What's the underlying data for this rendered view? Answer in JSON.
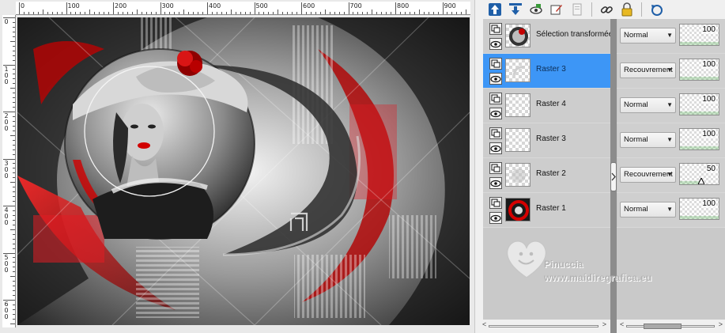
{
  "rulers": {
    "top_labels": [
      "0",
      "100",
      "200",
      "300",
      "400",
      "500",
      "600",
      "700",
      "800",
      "900"
    ],
    "left_labels": [
      "0",
      "100",
      "200",
      "300",
      "400",
      "500",
      "600"
    ]
  },
  "toolbar": {
    "icons": [
      "promote-layer-icon",
      "demote-layer-icon",
      "visibility-toggle-icon",
      "edit-layer-icon",
      "layer-properties-icon",
      "link-icon",
      "lock-icon",
      "refresh-icon"
    ]
  },
  "layers": [
    {
      "name": "Sélection transformée",
      "blend_mode": "Normal",
      "opacity": "100",
      "opacity_value": 100,
      "selected": false,
      "thumb": "portrait"
    },
    {
      "name": "Raster 3",
      "blend_mode": "Recouvrement",
      "opacity": "100",
      "opacity_value": 100,
      "selected": true,
      "thumb": "circle"
    },
    {
      "name": "Raster 4",
      "blend_mode": "Normal",
      "opacity": "100",
      "opacity_value": 100,
      "selected": false,
      "thumb": "empty"
    },
    {
      "name": "Raster 3",
      "blend_mode": "Normal",
      "opacity": "100",
      "opacity_value": 100,
      "selected": false,
      "thumb": "empty"
    },
    {
      "name": "Raster 2",
      "blend_mode": "Recouvrement",
      "opacity": "50",
      "opacity_value": 50,
      "selected": false,
      "thumb": "faint"
    },
    {
      "name": "Raster 1",
      "blend_mode": "Normal",
      "opacity": "100",
      "opacity_value": 100,
      "selected": false,
      "thumb": "swirl"
    }
  ],
  "watermark": {
    "name": "Pinuccia",
    "url": "www.maidiregrafica.eu"
  },
  "colors": {
    "selected_row": "#3d96f6",
    "accent_red": "#e11b22"
  }
}
